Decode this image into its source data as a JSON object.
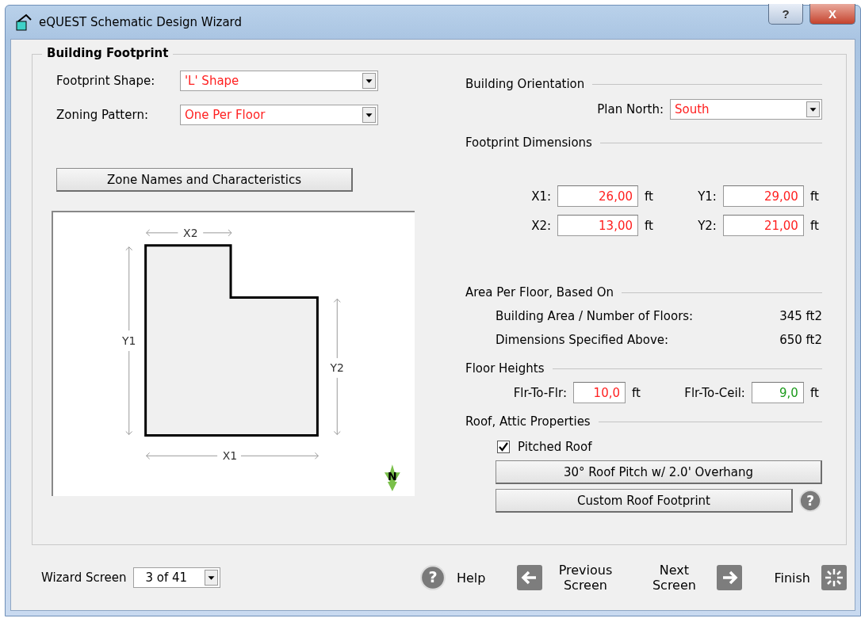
{
  "window": {
    "title": "eQUEST Schematic Design Wizard",
    "buttons": [
      "?",
      "X"
    ]
  },
  "group": {
    "title": "Building Footprint"
  },
  "left": {
    "selects": [
      {
        "label": "Footprint Shape:",
        "value": "'L' Shape",
        "kind": "user"
      },
      {
        "label": "Zoning Pattern:",
        "value": "One Per Floor",
        "kind": "user"
      }
    ],
    "zone_button": "Zone Names and Characteristics",
    "diagram": {
      "labels": [
        "X2",
        "Y1",
        "Y2",
        "X1"
      ],
      "north": "N"
    }
  },
  "orientation": {
    "title": "Building Orientation",
    "label": "Plan North:",
    "value": "South",
    "kind": "user"
  },
  "dimensions": {
    "title": "Footprint Dimensions",
    "fields": [
      {
        "label": "X1:",
        "value": "26,00",
        "unit": "ft",
        "kind": "user"
      },
      {
        "label": "Y1:",
        "value": "29,00",
        "unit": "ft",
        "kind": "user"
      },
      {
        "label": "X2:",
        "value": "13,00",
        "unit": "ft",
        "kind": "user"
      },
      {
        "label": "Y2:",
        "value": "21,00",
        "unit": "ft",
        "kind": "user"
      }
    ]
  },
  "area": {
    "title": "Area Per Floor, Based On",
    "rows": [
      {
        "label": "Building Area / Number of Floors:",
        "value": "345 ft2"
      },
      {
        "label": "Dimensions Specified Above:",
        "value": "650 ft2"
      }
    ]
  },
  "heights": {
    "title": "Floor Heights",
    "fields": [
      {
        "label": "Flr-To-Flr:",
        "value": "10,0",
        "unit": "ft",
        "kind": "user"
      },
      {
        "label": "Flr-To-Ceil:",
        "value": "9,0",
        "unit": "ft",
        "kind": "default"
      }
    ]
  },
  "roof": {
    "title": "Roof, Attic Properties",
    "checkbox": {
      "label": "Pitched Roof",
      "checked": true
    },
    "pitch_button": "30° Roof Pitch w/ 2.0' Overhang",
    "custom_button": "Custom Roof Footprint",
    "help": "?"
  },
  "footer": {
    "label": "Wizard Screen",
    "screen": "3 of 41",
    "help_icon": "?",
    "help": "Help",
    "previous": "Previous Screen",
    "next": "Next Screen",
    "finish": "Finish"
  }
}
